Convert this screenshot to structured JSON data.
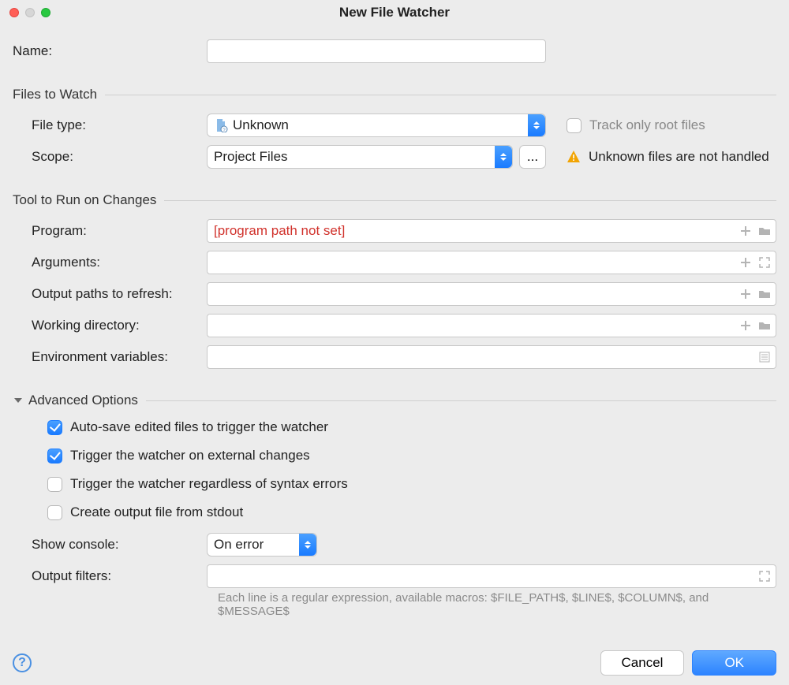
{
  "window": {
    "title": "New File Watcher"
  },
  "name": {
    "label": "Name:",
    "value": ""
  },
  "section_files": {
    "title": "Files to Watch",
    "file_type": {
      "label": "File type:",
      "value": "Unknown"
    },
    "track_root": {
      "label": "Track only root files",
      "checked": false
    },
    "scope": {
      "label": "Scope:",
      "value": "Project Files",
      "more": "..."
    },
    "warning": "Unknown files are not handled"
  },
  "section_tool": {
    "title": "Tool to Run on Changes",
    "program": {
      "label": "Program:",
      "placeholder": "[program path not set]",
      "value": ""
    },
    "arguments": {
      "label": "Arguments:",
      "value": ""
    },
    "out_paths": {
      "label": "Output paths to refresh:",
      "value": ""
    },
    "workdir": {
      "label": "Working directory:",
      "value": ""
    },
    "env": {
      "label": "Environment variables:",
      "value": ""
    }
  },
  "section_adv": {
    "title": "Advanced Options",
    "autosave": {
      "label": "Auto-save edited files to trigger the watcher",
      "checked": true
    },
    "external": {
      "label": "Trigger the watcher on external changes",
      "checked": true
    },
    "syntax": {
      "label": "Trigger the watcher regardless of syntax errors",
      "checked": false
    },
    "stdout": {
      "label": "Create output file from stdout",
      "checked": false
    },
    "show_console": {
      "label": "Show console:",
      "value": "On error"
    },
    "output_filters": {
      "label": "Output filters:",
      "value": ""
    },
    "hint": "Each line is a regular expression, available macros: $FILE_PATH$, $LINE$, $COLUMN$, and $MESSAGE$"
  },
  "buttons": {
    "cancel": "Cancel",
    "ok": "OK"
  }
}
